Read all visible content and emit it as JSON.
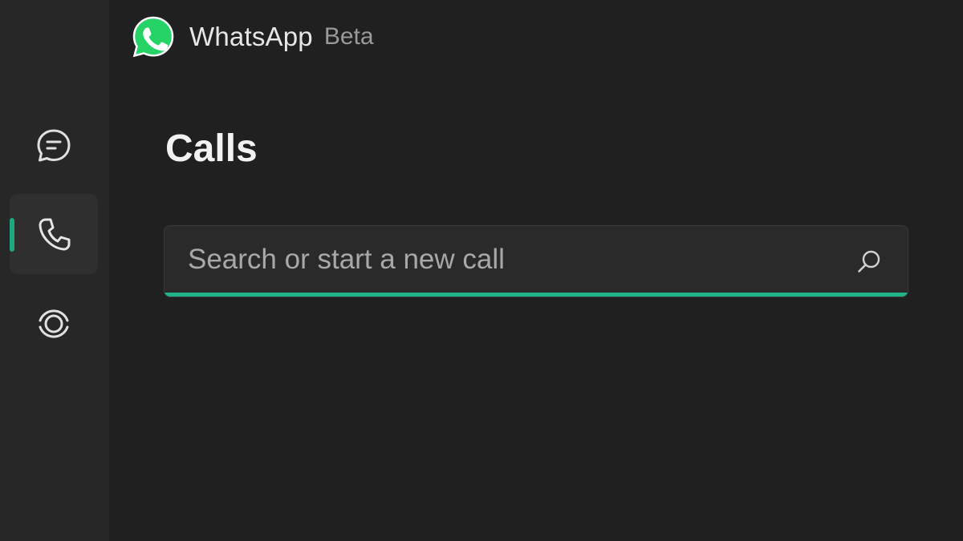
{
  "app": {
    "name": "WhatsApp",
    "badge": "Beta",
    "logo_icon": "whatsapp-logo-icon",
    "brand_color": "#25D366",
    "accent_color": "#20B38A"
  },
  "sidebar": {
    "items": [
      {
        "id": "chats",
        "icon": "chat-bubble-icon",
        "active": false
      },
      {
        "id": "calls",
        "icon": "phone-icon",
        "active": true
      },
      {
        "id": "status",
        "icon": "status-ring-icon",
        "active": false
      }
    ]
  },
  "main": {
    "title": "Calls",
    "search": {
      "placeholder": "Search or start a new call",
      "value": "",
      "icon": "search-icon"
    }
  }
}
